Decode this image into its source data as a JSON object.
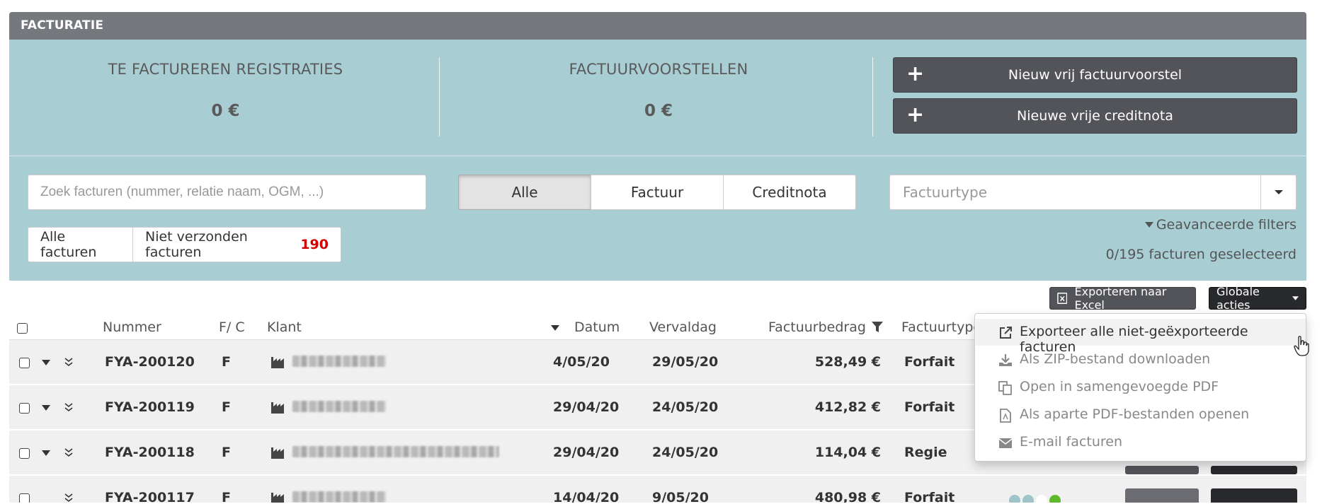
{
  "panel": {
    "title": "FACTURATIE"
  },
  "summary": {
    "stats": [
      {
        "title": "TE FACTUREREN REGISTRATIES",
        "value": "0 €"
      },
      {
        "title": "FACTUURVOORSTELLEN",
        "value": "0 €"
      }
    ],
    "buttons": [
      {
        "label": "Nieuw vrij factuurvoorstel",
        "icon": "plus-icon"
      },
      {
        "label": "Nieuwe vrije creditnota",
        "icon": "plus-icon"
      }
    ]
  },
  "filters": {
    "search_placeholder": "Zoek facturen (nummer, relatie naam, OGM, ...)",
    "segments": [
      "Alle",
      "Factuur",
      "Creditnota"
    ],
    "active_segment": "Alle",
    "type_placeholder": "Factuurtype",
    "all_invoices_label": "Alle facturen",
    "unsent_label": "Niet verzonden facturen",
    "unsent_count": "190",
    "advanced_label": "Geavanceerde filters",
    "selection_text": "0/195 facturen geselecteerd"
  },
  "toolbar": {
    "export_excel_label": "Exporteren naar Excel",
    "global_actions_label": "Globale acties"
  },
  "table": {
    "headers": {
      "number": "Nummer",
      "fc": "F/ C",
      "client": "Klant",
      "date": "Datum",
      "due": "Vervaldag",
      "amount": "Factuurbedrag",
      "type": "Factuurtype"
    },
    "rows": [
      {
        "number": "FYA-200120",
        "fc": "F",
        "date": "4/05/20",
        "due": "29/05/20",
        "amount": "528,49 €",
        "type": "Forfait"
      },
      {
        "number": "FYA-200119",
        "fc": "F",
        "date": "29/04/20",
        "due": "24/05/20",
        "amount": "412,82 €",
        "type": "Forfait"
      },
      {
        "number": "FYA-200118",
        "fc": "F",
        "date": "29/04/20",
        "due": "24/05/20",
        "amount": "114,04 €",
        "type": "Regie"
      },
      {
        "number": "FYA-200117",
        "fc": "F",
        "date": "14/04/20",
        "due": "9/05/20",
        "amount": "480,98 €",
        "type": "Forfait"
      }
    ]
  },
  "menu": {
    "items": [
      {
        "label": "Exporteer alle niet-geëxporteerde facturen",
        "icon": "external-link-icon"
      },
      {
        "label": "Als ZIP-bestand downloaden",
        "icon": "download-icon"
      },
      {
        "label": "Open in samengevoegde PDF",
        "icon": "copy-pdf-icon"
      },
      {
        "label": "Als aparte PDF-bestanden openen",
        "icon": "pdf-file-icon"
      },
      {
        "label": "E-mail facturen",
        "icon": "envelope-icon"
      }
    ]
  },
  "colors": {
    "panel_header": "#75787c",
    "panel_bg": "#a8cdd3",
    "dark_button": "#525459",
    "count_red": "#d40000"
  }
}
